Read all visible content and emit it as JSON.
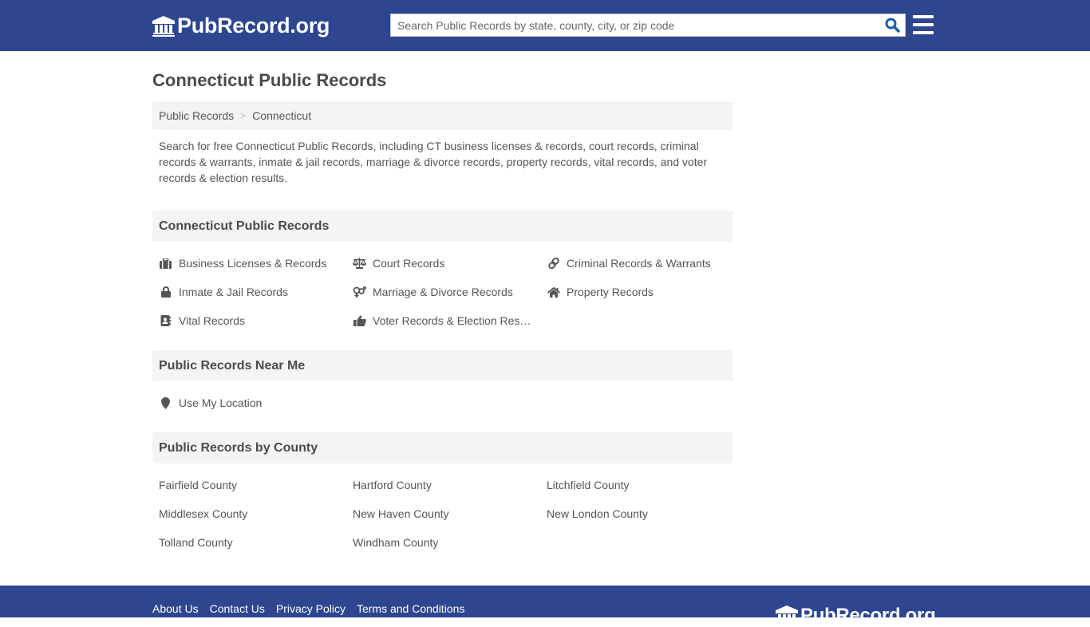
{
  "header": {
    "logo_text": "PubRecord.org",
    "search_placeholder": "Search Public Records by state, county, city, or zip code",
    "search_value": ""
  },
  "page": {
    "title": "Connecticut Public Records",
    "breadcrumb": [
      {
        "label": "Public Records"
      },
      {
        "label": "Connecticut"
      }
    ],
    "breadcrumb_sep": ">",
    "intro": "Search for free Connecticut Public Records, including CT business licenses & records, court records, criminal records & warrants, inmate & jail records, marriage & divorce records, property records, vital records, and voter records & election results."
  },
  "records_section": {
    "title": "Connecticut Public Records",
    "items": [
      {
        "label": "Business Licenses & Records",
        "icon": "briefcase-icon"
      },
      {
        "label": "Court Records",
        "icon": "scale-icon"
      },
      {
        "label": "Criminal Records & Warrants",
        "icon": "link-icon"
      },
      {
        "label": "Inmate & Jail Records",
        "icon": "lock-icon"
      },
      {
        "label": "Marriage & Divorce Records",
        "icon": "gender-icon"
      },
      {
        "label": "Property Records",
        "icon": "home-icon"
      },
      {
        "label": "Vital Records",
        "icon": "address-book-icon"
      },
      {
        "label": "Voter Records & Election Results",
        "icon": "thumbs-up-icon"
      }
    ]
  },
  "near_section": {
    "title": "Public Records Near Me",
    "items": [
      {
        "label": "Use My Location",
        "icon": "map-marker-icon"
      }
    ]
  },
  "county_section": {
    "title": "Public Records by County",
    "items": [
      {
        "label": "Fairfield County"
      },
      {
        "label": "Hartford County"
      },
      {
        "label": "Litchfield County"
      },
      {
        "label": "Middlesex County"
      },
      {
        "label": "New Haven County"
      },
      {
        "label": "New London County"
      },
      {
        "label": "Tolland County"
      },
      {
        "label": "Windham County"
      }
    ]
  },
  "footer": {
    "links": [
      {
        "label": "About Us"
      },
      {
        "label": "Contact Us"
      },
      {
        "label": "Privacy Policy"
      },
      {
        "label": "Terms and Conditions"
      }
    ],
    "logo_text": "PubRecord.org"
  },
  "colors": {
    "brand": "#2e4690",
    "search_icon": "#1a5fa8",
    "section_bg": "#f4f4f4",
    "text": "#555555"
  }
}
